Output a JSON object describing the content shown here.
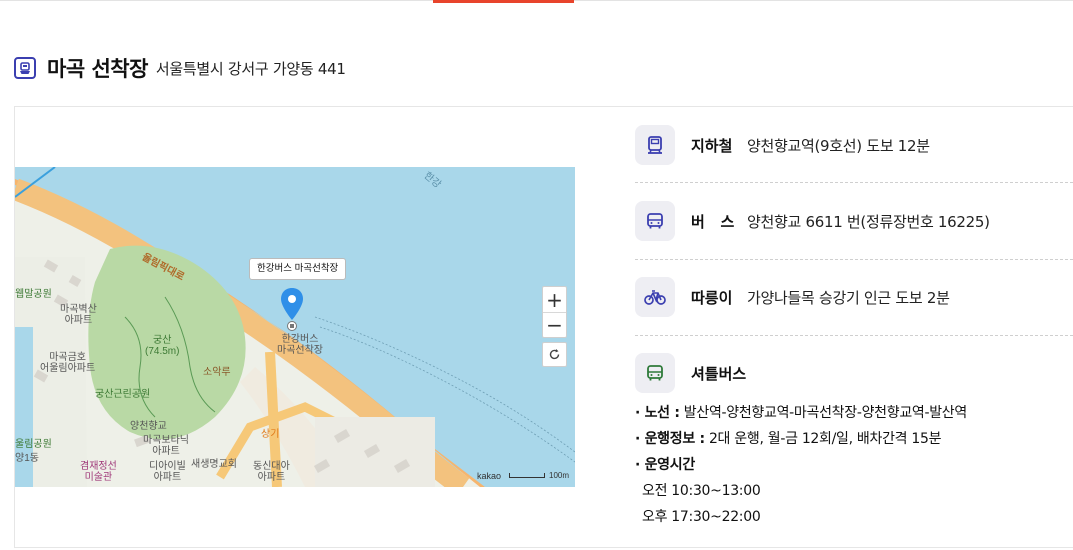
{
  "heading": {
    "icon": "ferry-icon",
    "title": "마곡 선착장",
    "address": "서울특별시 강서구 가양동 441"
  },
  "map": {
    "marker_label": "한강버스 마곡선착장",
    "stop_label_1": "한강버스",
    "stop_label_2": "마곡선착장",
    "road_label": "올림픽대로",
    "river_label": "한강",
    "places": {
      "park1": "궁산근린공원",
      "park2": "궁산",
      "park2_height": "(74.5m)",
      "school": "양천향교",
      "apt1_a": "마곡벽산",
      "apt1_b": "아파트",
      "apt2_a": "마곡금호",
      "apt2_b": "어울림아파트",
      "apt3_a": "마곡보타닉",
      "apt3_b": "아파트",
      "apt4_a": "디아이빌",
      "apt4_b": "아파트",
      "church": "새생명교회",
      "apt5_a": "동신대아",
      "apt5_b": "아파트",
      "museum_a": "겸재정선",
      "museum_b": "미술관",
      "park3": "웹말공원",
      "dong": "양1동",
      "park4": "울림공원",
      "soak": "소악루",
      "sanggi": "상기"
    },
    "attribution": "kakao",
    "scale_label": "100m",
    "zoom_in": "+",
    "zoom_out": "−"
  },
  "transit": [
    {
      "icon": "subway-icon",
      "label": "지하철",
      "value": "양천향교역(9호선) 도보 12분"
    },
    {
      "icon": "bus-icon",
      "label": "버   스",
      "value": "양천향교 6611 번(정류장번호 16225)"
    },
    {
      "icon": "bicycle-icon",
      "label": "따릉이",
      "value": "가양나들목 승강기 인근 도보 2분"
    },
    {
      "icon": "shuttle-bus-icon",
      "label": "셔틀버스",
      "value": ""
    }
  ],
  "shuttle": {
    "route_label": "· 노선 :",
    "route_value": "발산역-양천향교역-마곡선착장-양천향교역-발산역",
    "ops_label": "· 운행정보 :",
    "ops_value": "2대 운행, 월-금 12회/일, 배차간격 15분",
    "hours_label": "· 운영시간",
    "morning": "오전 10:30~13:00",
    "afternoon": "오후 17:30~22:00"
  },
  "colors": {
    "accent": "#e8442c",
    "icon_blue": "#3b3fb0",
    "icon_green": "#2f7a3a",
    "water": "#a9d7ea",
    "road": "#f6b56e",
    "park": "#b9d9a5",
    "marker": "#2f8fe8"
  }
}
